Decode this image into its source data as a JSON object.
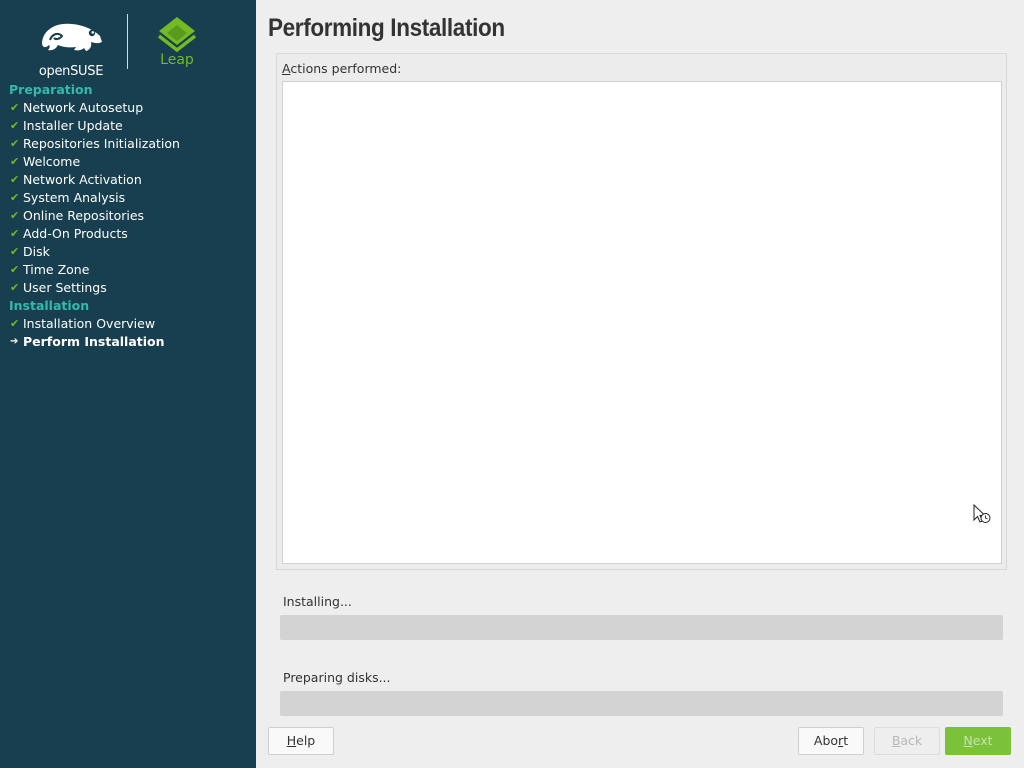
{
  "sidebar": {
    "brand_suse": "openSUSE",
    "brand_leap": "Leap",
    "groups": [
      {
        "label": "Preparation",
        "items": [
          {
            "label": "Network Autosetup",
            "state": "done"
          },
          {
            "label": "Installer Update",
            "state": "done"
          },
          {
            "label": "Repositories Initialization",
            "state": "done"
          },
          {
            "label": "Welcome",
            "state": "done"
          },
          {
            "label": "Network Activation",
            "state": "done"
          },
          {
            "label": "System Analysis",
            "state": "done"
          },
          {
            "label": "Online Repositories",
            "state": "done"
          },
          {
            "label": "Add-On Products",
            "state": "done"
          },
          {
            "label": "Disk",
            "state": "done"
          },
          {
            "label": "Time Zone",
            "state": "done"
          },
          {
            "label": "User Settings",
            "state": "done"
          }
        ]
      },
      {
        "label": "Installation",
        "items": [
          {
            "label": "Installation Overview",
            "state": "done"
          },
          {
            "label": "Perform Installation",
            "state": "current"
          }
        ]
      }
    ],
    "done_mark": "✔",
    "current_mark": "➔"
  },
  "main": {
    "title": "Performing Installation",
    "actions_label_accel": "A",
    "actions_label_rest": "ctions performed:",
    "actions_log": "",
    "progress1_label": "Installing...",
    "progress1_value": 0,
    "progress2_label": "Preparing disks...",
    "progress2_value": 0
  },
  "buttons": {
    "help_accel": "H",
    "help_rest": "elp",
    "abort_pre": "Abo",
    "abort_accel": "r",
    "abort_post": "t",
    "back_accel": "B",
    "back_rest": "ack",
    "next_accel": "N",
    "next_rest": "ext"
  },
  "colors": {
    "sidebar_bg": "#173f4f",
    "group_heading": "#35b9ab",
    "check": "#73ba25",
    "next_button": "#7cc13a"
  }
}
